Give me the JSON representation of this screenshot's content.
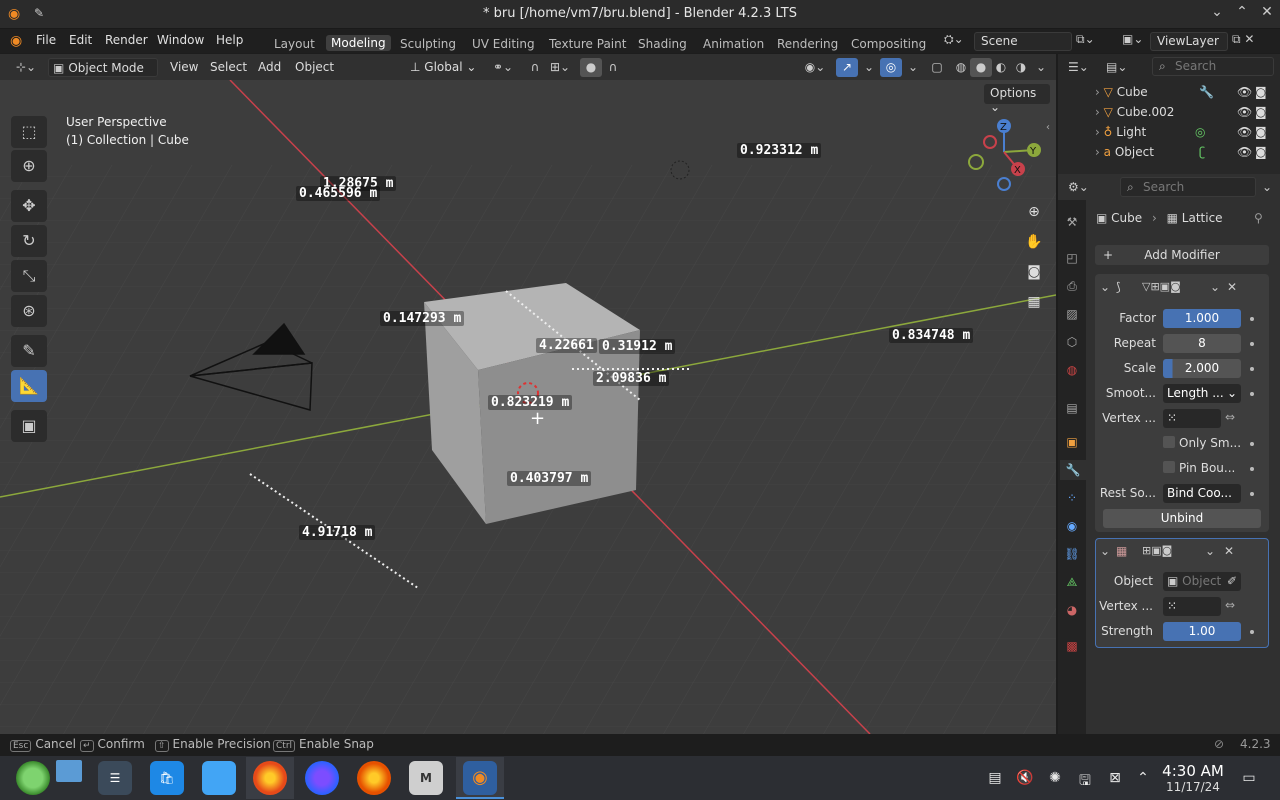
{
  "window": {
    "title": "* bru [/home/vm7/bru.blend] - Blender 4.2.3 LTS"
  },
  "menubar": {
    "items": [
      "File",
      "Edit",
      "Render",
      "Window",
      "Help"
    ],
    "workspaces": [
      "Layout",
      "Modeling",
      "Sculpting",
      "UV Editing",
      "Texture Paint",
      "Shading",
      "Animation",
      "Rendering",
      "Compositing"
    ],
    "active_workspace": "Modeling",
    "scene": "Scene",
    "view_layer": "ViewLayer"
  },
  "header3d": {
    "mode": "Object Mode",
    "menus": [
      "View",
      "Select",
      "Add",
      "Object"
    ],
    "orientation": "Global",
    "options_label": "Options"
  },
  "viewport": {
    "perspective": "User Perspective",
    "collection_line": "(1) Collection | Cube",
    "measurements": [
      "1.28675 m",
      "0.465596 m",
      "0.923312 m",
      "0.147293 m",
      "4.22661",
      "0.31912 m",
      "2.09836 m",
      "0.834748 m",
      "0.823219 m",
      "0.403797 m",
      "4.91718 m"
    ]
  },
  "outliner": {
    "search_placeholder": "Search",
    "items": [
      "Cube",
      "Cube.002",
      "Light",
      "Object"
    ]
  },
  "properties": {
    "search_placeholder": "Search",
    "breadcrumb_object": "Cube",
    "breadcrumb_modifier": "Lattice",
    "add_modifier": "Add Modifier",
    "smooth_corrective": {
      "factor_label": "Factor",
      "factor": "1.000",
      "repeat_label": "Repeat",
      "repeat": "8",
      "scale_label": "Scale",
      "scale": "2.000",
      "smooth_type_label": "Smoot...",
      "smooth_type": "Length ...",
      "vertex_group_label": "Vertex ...",
      "only_smooth_label": "Only Sm...",
      "pin_boundary_label": "Pin Bou...",
      "rest_source_label": "Rest So...",
      "rest_source": "Bind Coo...",
      "unbind_label": "Unbind"
    },
    "lattice": {
      "object_label": "Object",
      "object_placeholder": "Object",
      "vertex_group_label": "Vertex ...",
      "strength_label": "Strength",
      "strength": "1.00"
    }
  },
  "statusbar": {
    "cancel_key": "Esc",
    "cancel": "Cancel",
    "confirm": "Confirm",
    "precision": "Enable Precision",
    "snap_key": "Ctrl",
    "snap": "Enable Snap",
    "version": "4.2.3"
  },
  "taskbar": {
    "time": "4:30 AM",
    "date": "11/17/24"
  },
  "colors": {
    "accent_blue": "#4772b3",
    "x_axis": "#c8414b",
    "y_axis": "#8ca83c"
  }
}
